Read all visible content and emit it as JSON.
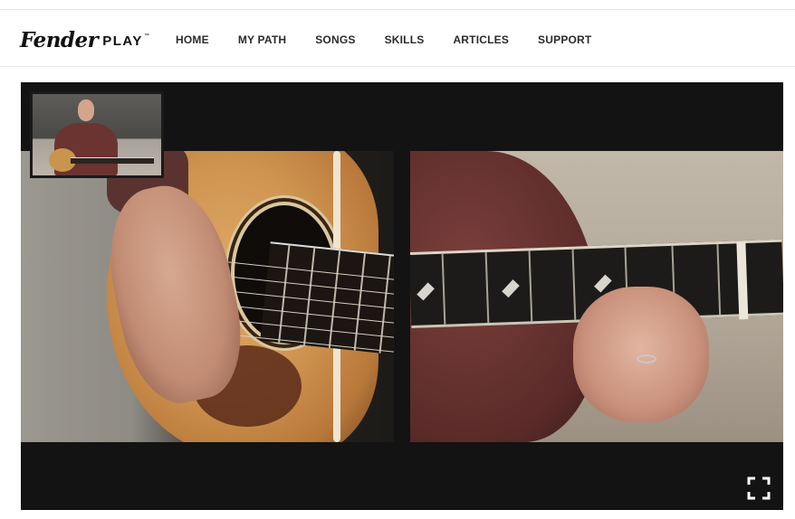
{
  "brand": {
    "logo_script": "Fender",
    "logo_play": "PLAY",
    "logo_tm": "™"
  },
  "nav": {
    "items": [
      {
        "label": "HOME"
      },
      {
        "label": "MY PATH"
      },
      {
        "label": "SONGS"
      },
      {
        "label": "SKILLS"
      },
      {
        "label": "ARTICLES"
      },
      {
        "label": "SUPPORT"
      }
    ]
  },
  "player": {
    "fullscreen_icon": "fullscreen-icon",
    "colors": {
      "letterbox": "#131313",
      "control": "#ffffff"
    }
  }
}
